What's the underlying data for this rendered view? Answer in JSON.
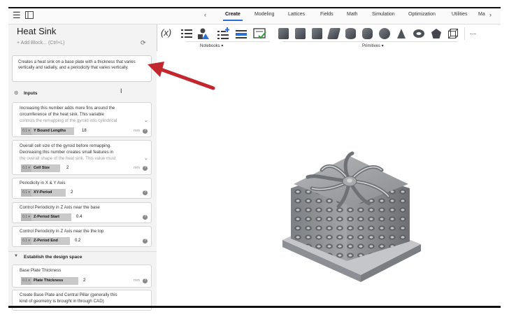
{
  "tabs": [
    "Create",
    "Modeling",
    "Lattices",
    "Fields",
    "Math",
    "Simulation",
    "Optimization",
    "Utilities",
    "Ma"
  ],
  "active_tab": "Create",
  "panel": {
    "title": "Heat Sink",
    "add_block": "+ Add Block... (Ctrl+L)",
    "description": "Creates a heat sink on a base plate with a thickness that varies vertically and radially, and a periodicity that varies vertically."
  },
  "toolbar": {
    "variable_icon": "(x)",
    "notebooks_label": "Notebooks ▾",
    "primitives_label": "Primitives ▾"
  },
  "sections": {
    "inputs": "Inputs",
    "design_space": "Establish the design space"
  },
  "params": [
    {
      "desc1": "Increasing this number adds more fins around the",
      "desc2": "circumference of the heat sink. This variable",
      "desc3": "controls the remapping of the gyroid into cylindrical",
      "label": "Y Bound Lengths",
      "value": "18",
      "unit": "mm"
    },
    {
      "desc1": "Overall cell size of the gyroid before remapping.",
      "desc2": "Decreasing this number creates small features in",
      "desc3": "the overall shape of the heat sink. This value must",
      "label": "Cell Size",
      "value": "2",
      "unit": "mm"
    },
    {
      "desc1": "Periodicity in X & Y Axis",
      "label": "XY-Period",
      "value": "2"
    },
    {
      "desc1": "Control Periodicity in Z Axis near the base",
      "label": "Z-Period Start",
      "value": "0.4"
    },
    {
      "desc1": "Control Periodicity in Z Axis near the the top",
      "label": "Z-Period End",
      "value": "0.2"
    },
    {
      "desc1": "Base Plate Thickness",
      "label": "Plate Thickness",
      "value": "2",
      "unit": "mm"
    }
  ],
  "last_card": {
    "line1": "Create Base Plate and Central Pillar (generally this",
    "line2": "kind of geometry is brought in through CAD)"
  },
  "unit_badge": "0.1 ▾",
  "colors": {
    "accent": "#2b6fd6",
    "arrow": "#c1272d",
    "panel_bg": "#f3f3f3"
  }
}
